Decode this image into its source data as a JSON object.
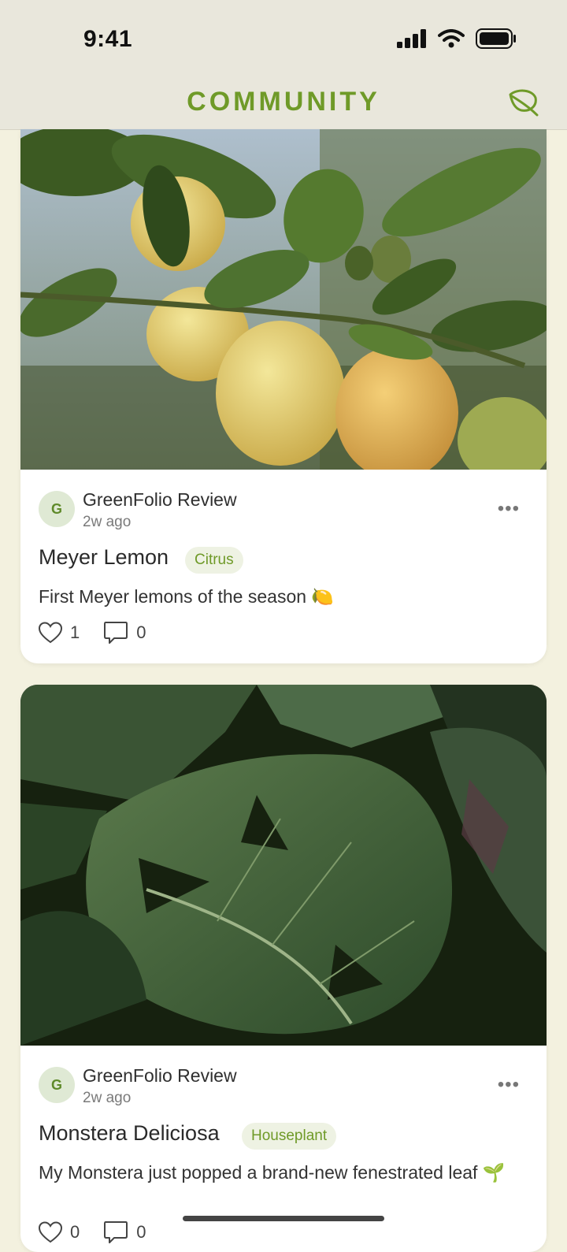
{
  "status": {
    "time": "9:41"
  },
  "nav": {
    "title": "COMMUNITY"
  },
  "posts": [
    {
      "avatar_initial": "G",
      "author": "GreenFolio Review",
      "time": "2w ago",
      "plant_name": "Meyer Lemon",
      "tag": "Citrus",
      "caption": "First Meyer lemons of the season 🍋",
      "likes": "1",
      "comments": "0"
    },
    {
      "avatar_initial": "G",
      "author": "GreenFolio Review",
      "time": "2w ago",
      "plant_name": "Monstera Deliciosa",
      "tag": "Houseplant",
      "caption": "My Monstera just popped a brand-new fenestrated leaf 🌱",
      "likes": "0",
      "comments": "0"
    }
  ],
  "colors": {
    "accent": "#6f9a28",
    "background": "#f3f1df",
    "header": "#e9e7dc"
  },
  "icons": [
    "signal-icon",
    "wifi-icon",
    "battery-icon",
    "leaf-icon",
    "more-icon",
    "heart-icon",
    "comment-icon"
  ]
}
